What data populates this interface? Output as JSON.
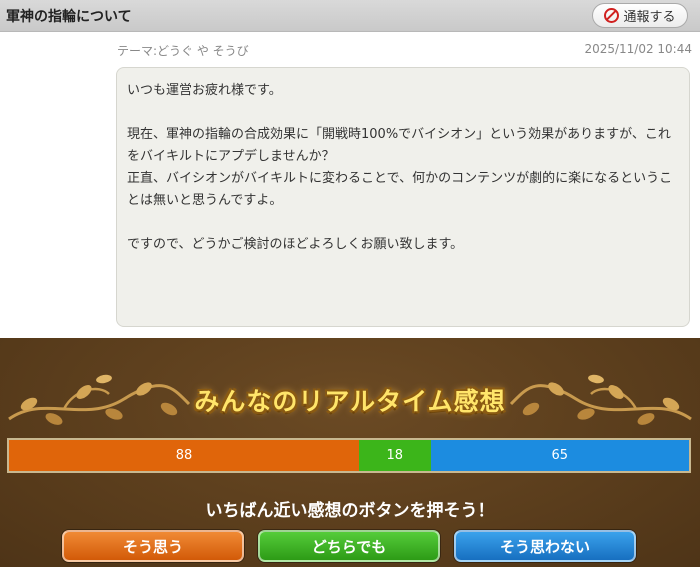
{
  "header": {
    "title": "軍神の指輪について",
    "report_label": "通報する"
  },
  "post": {
    "theme": "テーマ:どうぐ や そうび",
    "date": "2025/11/02 10:44",
    "lines": [
      "いつも運営お疲れ様です。",
      "",
      "現在、軍神の指輪の合成効果に「開戦時100%でバイシオン」という効果がありますが、これをバイキルトにアプデしませんか？",
      "正直、バイシオンがバイキルトに変わることで、何かのコンテンツが劇的に楽になるということは無いと思うんですよ。",
      "",
      "ですので、どうかご検討のほどよろしくお願い致します。"
    ]
  },
  "realtime": {
    "title": "みんなのリアルタイム感想",
    "results": {
      "agree": 88,
      "either": 18,
      "disagree": 65
    },
    "prompt": "いちばん近い感想のボタンを押そう！",
    "buttons": {
      "agree": "そう思う",
      "either": "どちらでも",
      "disagree": "そう思わない"
    }
  },
  "colors": {
    "agree": "#e0650a",
    "either": "#3cb51a",
    "disagree": "#1c8ce0",
    "panel_bg": "#5c3f1e",
    "title_gold": "#ffe56a"
  },
  "icons": {
    "report": "ban-icon",
    "ornament": "vine-ornament"
  }
}
